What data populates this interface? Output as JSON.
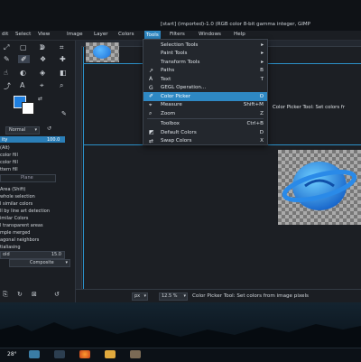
{
  "window": {
    "title": "[start] (imported)-1.0 (RGB color 8-bit gamma integer, GIMP"
  },
  "menubar": {
    "items": [
      "dit",
      "Select",
      "View",
      "Image",
      "Layer",
      "Colors",
      "Tools",
      "Filters",
      "Windows",
      "Help"
    ],
    "active": "Tools"
  },
  "tools_menu": {
    "items": [
      {
        "label": "Selection Tools",
        "accel": "▸"
      },
      {
        "label": "Paint Tools",
        "accel": "▸"
      },
      {
        "label": "Transform Tools",
        "accel": "▸"
      },
      {
        "label": "Paths",
        "accel": "B"
      },
      {
        "label": "Text",
        "accel": "T"
      },
      {
        "label": "GEGL Operation...",
        "accel": ""
      },
      {
        "label": "Color Picker",
        "accel": "O"
      },
      {
        "label": "Measure",
        "accel": "Shift+M"
      },
      {
        "label": "Zoom",
        "accel": "Z"
      },
      {
        "label": "Toolbox",
        "accel": "Ctrl+B"
      },
      {
        "label": "Default Colors",
        "accel": "D"
      },
      {
        "label": "Swap Colors",
        "accel": "X"
      }
    ],
    "highlighted": "Color Picker"
  },
  "tooltip": {
    "text": "Color Picker Tool: Set colors fr"
  },
  "tool_options": {
    "mode_label": "Normal",
    "opacity_label": "ity",
    "opacity_value": "100.0",
    "mode_section": "(Alt)",
    "rows": [
      "color fill",
      "color fill",
      "ttern fill"
    ],
    "fill_whole": "Area (Shift)",
    "area_rows": [
      "whole selection",
      "l similar colors",
      "ll by line art detection"
    ],
    "similar_colors": "imilar Colors",
    "transparent": "l transparent areas",
    "sample_merged": "mple merged",
    "diagonal": "agonal neighbors",
    "antialias": "tialiasing",
    "threshold_label": "old",
    "threshold_value": "15.0",
    "composite_label": "Composite",
    "plane_label": "Plane"
  },
  "statusbar": {
    "unit": "px",
    "zoom": "12.5 %",
    "message": "Color Picker Tool: Set colors from image pixels"
  },
  "taskbar": {
    "temperature": "28°"
  },
  "colors": {
    "accent": "#2e88c3",
    "foreground": "#1e7fe0",
    "background": "#ffffff"
  }
}
